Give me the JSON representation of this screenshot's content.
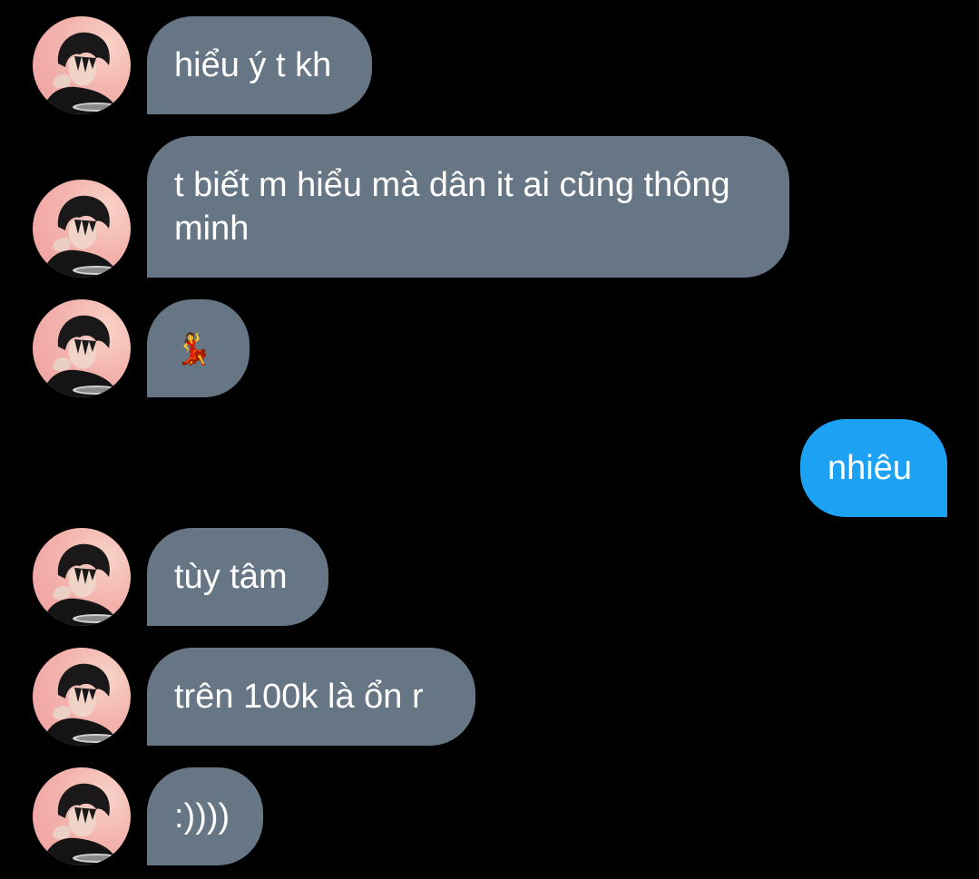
{
  "colors": {
    "background": "#000000",
    "received_bubble": "#677684",
    "sent_bubble": "#1da1f2",
    "text": "#ffffff"
  },
  "messages": [
    {
      "direction": "received",
      "text": "hiểu ý t kh"
    },
    {
      "direction": "received",
      "text": "t biết m hiểu mà dân it ai cũng thông minh"
    },
    {
      "direction": "received",
      "text": "💃",
      "icon": "dancing-woman-emoji"
    },
    {
      "direction": "sent",
      "text": "nhiêu"
    },
    {
      "direction": "received",
      "text": "tùy tâm"
    },
    {
      "direction": "received",
      "text": "trên 100k là ổn r"
    },
    {
      "direction": "received",
      "text": ":))))"
    }
  ]
}
